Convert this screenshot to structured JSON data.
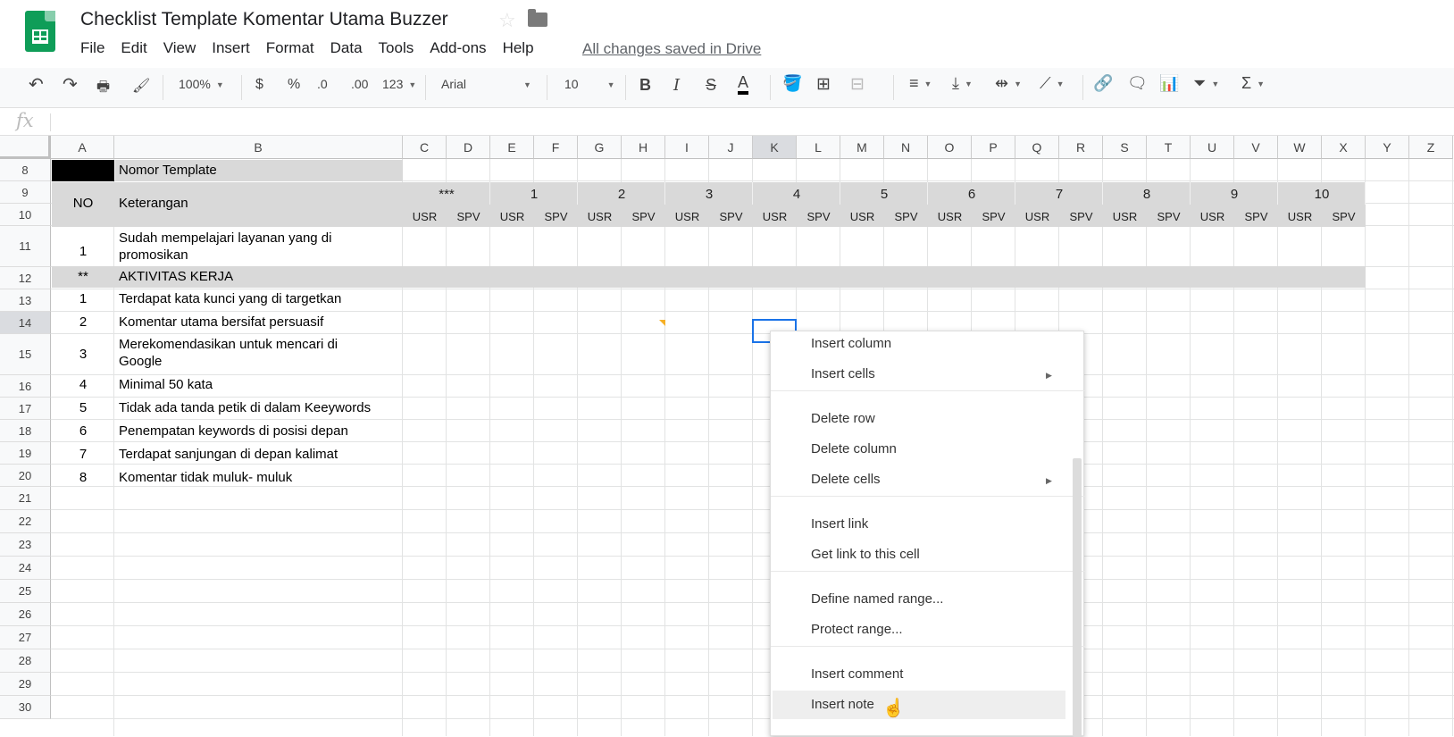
{
  "doc": {
    "title": "Checklist Template Komentar Utama Buzzer",
    "saved_status": "All changes saved in Drive"
  },
  "menu": [
    "File",
    "Edit",
    "View",
    "Insert",
    "Format",
    "Data",
    "Tools",
    "Add-ons",
    "Help"
  ],
  "toolbar": {
    "zoom": "100%",
    "currency": "$",
    "percent": "%",
    "dec_less": ".0",
    "dec_more": ".00",
    "more_formats": "123",
    "font": "Arial",
    "font_size": "10"
  },
  "formula": {
    "fx": "fx",
    "value": ""
  },
  "columns": [
    "A",
    "B",
    "C",
    "D",
    "E",
    "F",
    "G",
    "H",
    "I",
    "J",
    "K",
    "L",
    "M",
    "N",
    "O",
    "P",
    "Q",
    "R",
    "S",
    "T",
    "U",
    "V",
    "W",
    "X",
    "Y",
    "Z"
  ],
  "rows": [
    "8",
    "9",
    "10",
    "11",
    "12",
    "13",
    "14",
    "15",
    "16",
    "17",
    "18",
    "19",
    "20",
    "21",
    "22",
    "23",
    "24",
    "25",
    "26",
    "27",
    "28",
    "29",
    "30"
  ],
  "sheet": {
    "nomor_template": "Nomor Template",
    "no_header": "NO",
    "keterangan_header": "Keterangan",
    "group_headers": [
      "***",
      "1",
      "2",
      "3",
      "4",
      "5",
      "6",
      "7",
      "8",
      "9",
      "10"
    ],
    "sub_usr": "USR",
    "sub_spv": "SPV",
    "row11_no": "1",
    "row11_text": "Sudah mempelajari layanan yang di promosikan",
    "row12_no": "**",
    "row12_text": "AKTIVITAS KERJA",
    "items": [
      {
        "no": "1",
        "text": "Terdapat kata kunci yang di targetkan"
      },
      {
        "no": "2",
        "text": "Komentar utama bersifat persuasif"
      },
      {
        "no": "3",
        "text": "Merekomendasikan untuk mencari di Google"
      },
      {
        "no": "4",
        "text": "Minimal 50 kata"
      },
      {
        "no": "5",
        "text": "Tidak ada tanda petik di dalam Keeywords"
      },
      {
        "no": "6",
        "text": "Penempatan keywords di posisi depan"
      },
      {
        "no": "7",
        "text": "Terdapat sanjungan di depan kalimat"
      },
      {
        "no": "8",
        "text": "Komentar tidak muluk- muluk"
      }
    ]
  },
  "context_menu": {
    "insert_column": "Insert column",
    "insert_cells": "Insert cells",
    "delete_row": "Delete row",
    "delete_column": "Delete column",
    "delete_cells": "Delete cells",
    "insert_link": "Insert link",
    "get_link": "Get link to this cell",
    "define_range": "Define named range...",
    "protect_range": "Protect range...",
    "insert_comment": "Insert comment",
    "insert_note": "Insert note"
  }
}
